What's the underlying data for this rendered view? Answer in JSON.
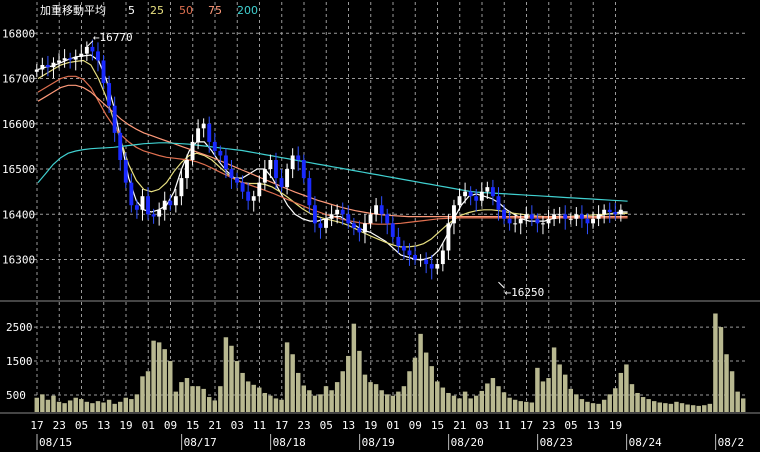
{
  "chart_data": {
    "type": "candlestick",
    "legend": {
      "title": "加重移動平均",
      "items": [
        {
          "label": "5",
          "color": "#ffffff"
        },
        {
          "label": "25",
          "color": "#e8e080"
        },
        {
          "label": "50",
          "color": "#e07050"
        },
        {
          "label": "75",
          "color": "#ff9a7a"
        },
        {
          "label": "200",
          "color": "#40d0d0"
        }
      ]
    },
    "price_axis": {
      "ticks": [
        16300,
        16400,
        16500,
        16600,
        16700,
        16800
      ],
      "ylim": [
        16215,
        16825
      ]
    },
    "volume_axis": {
      "ticks": [
        500,
        1500,
        2500
      ],
      "ylim": [
        0,
        3150
      ]
    },
    "annotations": [
      {
        "text": "16770",
        "value": 16770,
        "bar": 9
      },
      {
        "text": "16250",
        "value": 16250,
        "bar": 83
      }
    ],
    "time_ticks": [
      "17",
      "23",
      "05",
      "13",
      "19",
      "01",
      "09",
      "15",
      "21",
      "03",
      "11",
      "17",
      "23",
      "05",
      "13",
      "19",
      "01",
      "09",
      "15",
      "21",
      "03",
      "11",
      "17",
      "23",
      "05",
      "13",
      "19"
    ],
    "date_labels": [
      {
        "text": "08/15",
        "bar": 0
      },
      {
        "text": "08/17",
        "bar": 26
      },
      {
        "text": "08/18",
        "bar": 42
      },
      {
        "text": "08/19",
        "bar": 58
      },
      {
        "text": "08/20",
        "bar": 74
      },
      {
        "text": "08/23",
        "bar": 90
      },
      {
        "text": "08/24",
        "bar": 106
      },
      {
        "text": "08/2",
        "bar": 122
      }
    ],
    "bar_count": 128,
    "price_series": [
      16720,
      16730,
      16725,
      16735,
      16740,
      16745,
      16742,
      16748,
      16755,
      16770,
      16760,
      16740,
      16690,
      16640,
      16580,
      16520,
      16470,
      16420,
      16410,
      16440,
      16400,
      16395,
      16410,
      16430,
      16420,
      16440,
      16480,
      16520,
      16560,
      16590,
      16600,
      16560,
      16540,
      16530,
      16500,
      16480,
      16470,
      16450,
      16430,
      16440,
      16470,
      16500,
      16520,
      16480,
      16460,
      16500,
      16530,
      16520,
      16480,
      16420,
      16380,
      16370,
      16390,
      16400,
      16410,
      16400,
      16380,
      16370,
      16360,
      16380,
      16400,
      16420,
      16400,
      16380,
      16350,
      16330,
      16320,
      16310,
      16300,
      16300,
      16290,
      16280,
      16290,
      16320,
      16380,
      16420,
      16440,
      16450,
      16440,
      16430,
      16450,
      16460,
      16440,
      16410,
      16390,
      16380,
      16380,
      16390,
      16400,
      16390,
      16380,
      16380,
      16390,
      16400,
      16400,
      16390,
      16390,
      16400,
      16390,
      16380,
      16390,
      16400,
      16410,
      16405,
      16400,
      16410
    ],
    "ma_series": [
      {
        "name": "5",
        "color": "#ffffff",
        "values": [
          16720,
          16725,
          16728,
          16735,
          16742,
          16748,
          16750,
          16752,
          16740,
          16700,
          16640,
          16560,
          16480,
          16430,
          16410,
          16405,
          16410,
          16420,
          16450,
          16500,
          16540,
          16560,
          16560,
          16540,
          16515,
          16495,
          16480,
          16480,
          16490,
          16500,
          16500,
          16480,
          16450,
          16420,
          16400,
          16390,
          16385,
          16385,
          16390,
          16395,
          16395,
          16385,
          16375,
          16365,
          16360,
          16350,
          16340,
          16325,
          16310,
          16305,
          16300,
          16300,
          16305,
          16320,
          16350,
          16390,
          16420,
          16440,
          16445,
          16440,
          16435,
          16425,
          16410,
          16400,
          16390,
          16385,
          16385,
          16385,
          16390,
          16392,
          16395,
          16395,
          16395,
          16395,
          16395,
          16400,
          16402,
          16405,
          16405
        ]
      },
      {
        "name": "25",
        "color": "#e8e080",
        "values": [
          16700,
          16710,
          16720,
          16730,
          16735,
          16738,
          16740,
          16730,
          16700,
          16660,
          16610,
          16560,
          16510,
          16475,
          16455,
          16450,
          16455,
          16470,
          16495,
          16515,
          16530,
          16535,
          16530,
          16520,
          16505,
          16490,
          16478,
          16470,
          16468,
          16468,
          16466,
          16460,
          16450,
          16438,
          16425,
          16412,
          16402,
          16395,
          16390,
          16386,
          16382,
          16376,
          16368,
          16360,
          16352,
          16345,
          16338,
          16332,
          16328,
          16328,
          16330,
          16335,
          16345,
          16360,
          16375,
          16388,
          16398,
          16404,
          16408,
          16410,
          16410,
          16408,
          16405,
          16402,
          16400,
          16398,
          16396,
          16395,
          16395,
          16395,
          16395,
          16396,
          16397,
          16398,
          16399,
          16400,
          16401,
          16402,
          16402
        ]
      },
      {
        "name": "50",
        "color": "#e07050",
        "values": [
          16670,
          16680,
          16690,
          16700,
          16705,
          16705,
          16698,
          16680,
          16650,
          16620,
          16595,
          16575,
          16560,
          16548,
          16540,
          16535,
          16530,
          16526,
          16524,
          16522,
          16520,
          16516,
          16510,
          16502,
          16494,
          16486,
          16478,
          16471,
          16465,
          16459,
          16453,
          16447,
          16440,
          16433,
          16426,
          16419,
          16412,
          16406,
          16400,
          16395,
          16390,
          16386,
          16383,
          16380,
          16379,
          16378,
          16378,
          16379,
          16380,
          16382,
          16384,
          16386,
          16388,
          16390,
          16391,
          16392,
          16392,
          16392,
          16392,
          16392,
          16392,
          16392,
          16392,
          16392,
          16392,
          16392,
          16392,
          16392,
          16392,
          16392,
          16392,
          16392,
          16392,
          16392,
          16392,
          16392,
          16392,
          16392,
          16392
        ]
      },
      {
        "name": "75",
        "color": "#ff9a7a",
        "values": [
          16650,
          16660,
          16670,
          16680,
          16685,
          16685,
          16680,
          16670,
          16655,
          16640,
          16625,
          16610,
          16598,
          16588,
          16580,
          16574,
          16568,
          16562,
          16556,
          16550,
          16544,
          16538,
          16532,
          16526,
          16519,
          16512,
          16505,
          16498,
          16491,
          16484,
          16477,
          16470,
          16463,
          16456,
          16449,
          16443,
          16437,
          16431,
          16426,
          16421,
          16416,
          16412,
          16408,
          16405,
          16402,
          16400,
          16398,
          16397,
          16396,
          16395,
          16395,
          16395,
          16395,
          16395,
          16395,
          16395,
          16395,
          16395,
          16395,
          16395,
          16395,
          16395,
          16395,
          16395,
          16395,
          16395,
          16395,
          16395,
          16395,
          16395,
          16395,
          16395,
          16395,
          16395,
          16395,
          16395,
          16395,
          16395,
          16395
        ]
      },
      {
        "name": "200",
        "color": "#40d0d0",
        "values": [
          16470,
          16490,
          16510,
          16525,
          16535,
          16540,
          16543,
          16545,
          16546,
          16547,
          16548,
          16550,
          16552,
          16554,
          16556,
          16557,
          16558,
          16558,
          16557,
          16556,
          16555,
          16553,
          16551,
          16549,
          16547,
          16545,
          16543,
          16541,
          16538,
          16535,
          16532,
          16529,
          16526,
          16523,
          16520,
          16517,
          16514,
          16511,
          16508,
          16505,
          16502,
          16499,
          16496,
          16493,
          16490,
          16487,
          16484,
          16481,
          16478,
          16475,
          16472,
          16469,
          16466,
          16463,
          16460,
          16457,
          16454,
          16451,
          16449,
          16448,
          16447,
          16446,
          16445,
          16444,
          16443,
          16442,
          16441,
          16440,
          16439,
          16438,
          16437,
          16436,
          16435,
          16434,
          16433,
          16432,
          16431,
          16430,
          16429
        ]
      }
    ],
    "volume": [
      420,
      520,
      360,
      480,
      300,
      260,
      340,
      420,
      380,
      300,
      260,
      320,
      280,
      360,
      240,
      300,
      420,
      380,
      520,
      1050,
      1200,
      2100,
      2050,
      1850,
      1500,
      600,
      880,
      1000,
      760,
      760,
      680,
      440,
      340,
      760,
      2200,
      1950,
      1500,
      1150,
      900,
      800,
      720,
      560,
      480,
      400,
      360,
      2050,
      1700,
      1150,
      780,
      640,
      480,
      520,
      760,
      640,
      880,
      1200,
      1650,
      2600,
      1800,
      1100,
      880,
      820,
      640,
      520,
      480,
      600,
      760,
      1200,
      1600,
      2300,
      1750,
      1350,
      900,
      720,
      560,
      480,
      400,
      600,
      400,
      480,
      620,
      840,
      1000,
      760,
      580,
      420,
      360,
      320,
      300,
      280,
      1300,
      900,
      1000,
      1900,
      1400,
      1100,
      680,
      520,
      380,
      300,
      260,
      240,
      360,
      520,
      700,
      1150,
      1400,
      820,
      560,
      440,
      380,
      320,
      280,
      260,
      240,
      300,
      260,
      220,
      200,
      180,
      200,
      240,
      2900,
      2500,
      1700,
      1200,
      600,
      400
    ]
  }
}
